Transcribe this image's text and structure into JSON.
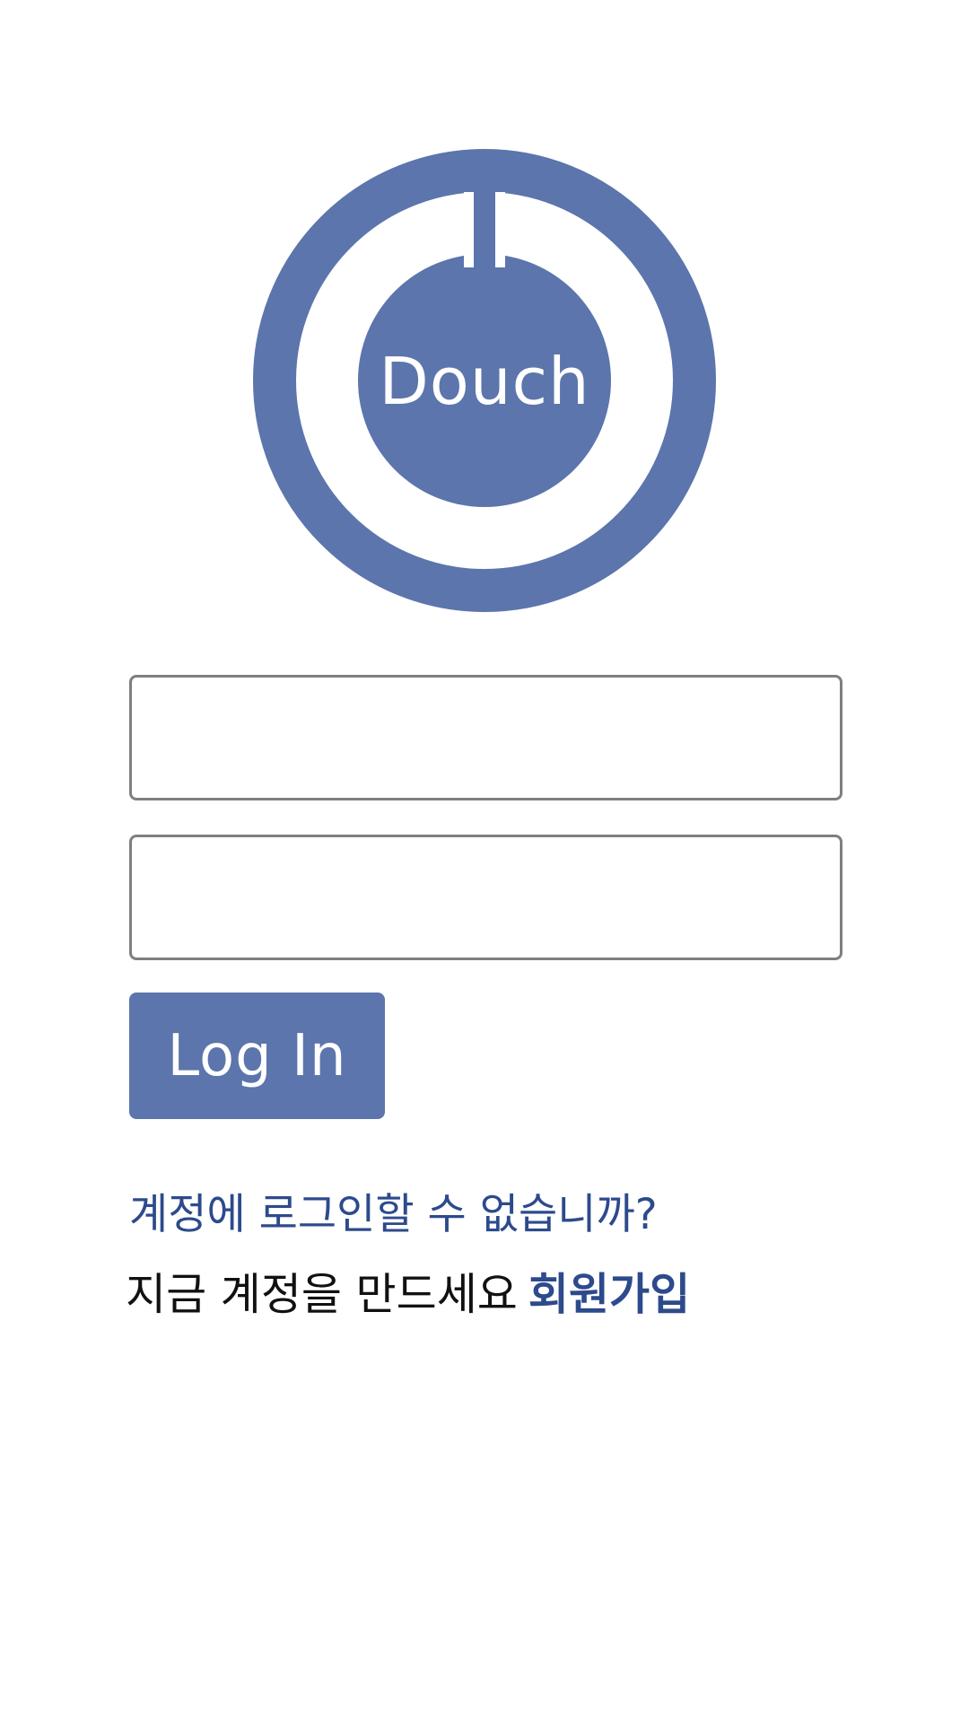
{
  "brand": {
    "logo_text": "Douch",
    "accent_color": "#5c75ac",
    "link_color": "#2d4a8c"
  },
  "login_form": {
    "username": {
      "value": "",
      "placeholder": ""
    },
    "password": {
      "value": "",
      "placeholder": ""
    },
    "login_button_label": "Log In"
  },
  "help_link_label": "계정에 로그인할 수 없습니까?",
  "signup": {
    "prompt": "지금 계정을 만드세요",
    "link_label": "회원가입"
  },
  "icons": {
    "logo": "power-ring-logo-icon"
  }
}
